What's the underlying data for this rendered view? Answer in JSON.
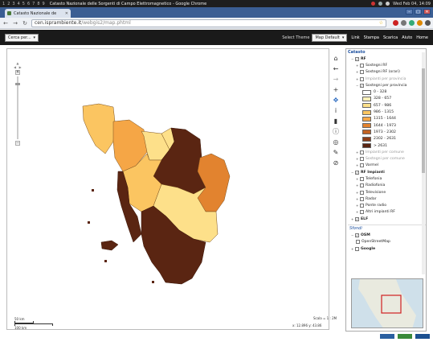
{
  "os_bar": {
    "workspaces": [
      "1",
      "2",
      "3",
      "4",
      "5",
      "6",
      "7",
      "8",
      "9"
    ],
    "window_title": "Catasto Nazionale delle Sorgenti di Campo Elettromagnetico - Google Chrome",
    "clock": "Wed Feb 04, 14:09"
  },
  "browser": {
    "tab_title": "Catasto Nazionale de",
    "url_domain": "cen.isprambiente.it",
    "url_path": "/webgis2/map.phtml"
  },
  "appbar": {
    "search_select": "Cerca per...",
    "theme_label": "Select Theme",
    "theme_value": "Map Default",
    "links": [
      "Link",
      "Stampa",
      "Scarica",
      "Aiuto",
      "Home"
    ]
  },
  "map": {
    "scalebar_top": "50 km",
    "scalebar_bottom": "100 km",
    "scale": "Scala = 1 : 2M",
    "coords": "x: 12.896  y: 43.86"
  },
  "legend": {
    "root": "Catasto",
    "rf_group": "RF",
    "items_rf": [
      "Sostegni RF",
      "Sostegni RF (orari)",
      "Impianti per provincia",
      "Sostegni per provincia"
    ],
    "classes": [
      {
        "label": "0 - 328",
        "color": "#ffffff"
      },
      {
        "label": "328 - 657",
        "color": "#fdf0b8"
      },
      {
        "label": "657 - 986",
        "color": "#fde08a"
      },
      {
        "label": "986 - 1315",
        "color": "#fbc561"
      },
      {
        "label": "1315 - 1644",
        "color": "#f5a646"
      },
      {
        "label": "1644 - 1973",
        "color": "#e2832f"
      },
      {
        "label": "1973 - 2302",
        "color": "#c46323"
      },
      {
        "label": "2302 - 2631",
        "color": "#8d3d18"
      },
      {
        "label": "> 2631",
        "color": "#5a2512"
      }
    ],
    "items_after": [
      "Impianti per comune",
      "Sostegni per comune",
      "Varmel"
    ],
    "rf_impianti": "RF Impianti",
    "impianti_items": [
      "Telefonia",
      "Radiofonia",
      "Televisione",
      "Radar",
      "Ponte radio",
      "Altri impianti RF"
    ],
    "elf": "ELF",
    "sfondi": "Sfondi",
    "osm": "OSM",
    "osm_item": "OpenStreetMap",
    "google": "Google"
  }
}
